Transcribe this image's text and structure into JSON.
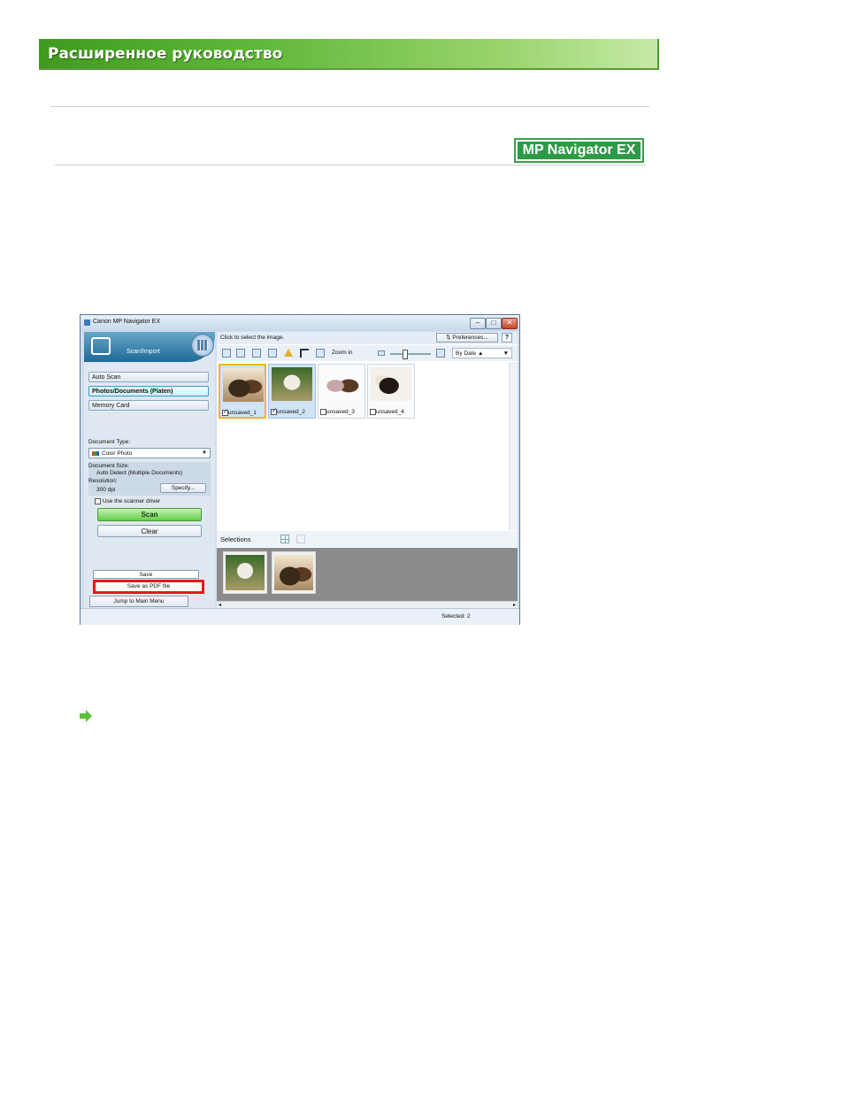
{
  "header": {
    "title": "Расширенное руководство"
  },
  "badge": {
    "label": "MP Navigator EX"
  },
  "window": {
    "title": "Canon MP Navigator EX",
    "controls": [
      "–",
      "□",
      "✕"
    ],
    "left": {
      "section": "Scan/Import",
      "nav": [
        "Auto Scan",
        "Photos/Documents (Platen)",
        "Memory Card"
      ],
      "active_nav": "Photos/Documents (Platen)",
      "document_type_label": "Document Type:",
      "document_type_value": "Color Photo",
      "document_size_label": "Document Size:",
      "document_size_value": "Auto Detect (Multiple Documents)",
      "resolution_label": "Resolution:",
      "resolution_value": "300 dpi",
      "specify_label": "Specify...",
      "scanner_driver_label": "Use the scanner driver",
      "scan_label": "Scan",
      "clear_label": "Clear",
      "save_label": "Save",
      "save_pdf_label": "Save as PDF file",
      "jump_label": "Jump to Main Menu"
    },
    "right": {
      "instruction": "Click to select the image.",
      "preferences_label": "Preferences...",
      "help_label": "?",
      "zoom_label": "Zoom in",
      "sort_label": "By Date",
      "thumbnails": [
        {
          "name": "unsaved_1",
          "checked": true
        },
        {
          "name": "unsaved_2",
          "checked": true
        },
        {
          "name": "unsaved_3",
          "checked": false
        },
        {
          "name": "unsaved_4",
          "checked": false
        }
      ],
      "selections_label": "Selections",
      "status": "Selected: 2"
    }
  },
  "colors": {
    "banner": "#5fb83a",
    "badge": "#2f9a45",
    "highlight": "#e21a1a",
    "arrow": "#5cc03a"
  }
}
